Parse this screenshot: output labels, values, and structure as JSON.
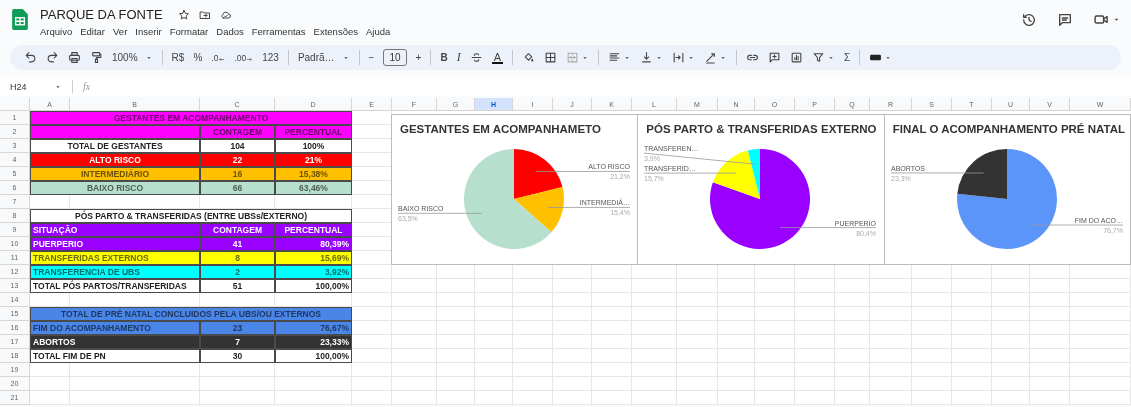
{
  "app": {
    "title": "PARQUE DA FONTE",
    "menu": [
      "Arquivo",
      "Editar",
      "Ver",
      "Inserir",
      "Formatar",
      "Dados",
      "Ferramentas",
      "Extensões",
      "Ajuda"
    ]
  },
  "toolbar": {
    "zoom": "100%",
    "currency": "R$",
    "percent": "%",
    "decrease_decimals": ".0",
    "increase_decimals": ".00",
    "number_format": "123",
    "font": "Padrã…",
    "decrease_size": "−",
    "font_size": "10",
    "increase_size": "+",
    "bold": "B",
    "italic": "I",
    "text_color": "A",
    "sum": "Σ"
  },
  "formula_bar": {
    "cell_ref": "H24",
    "fx": "fx"
  },
  "sheet": {
    "columns": [
      {
        "label": "A",
        "selected": false
      },
      {
        "label": "B",
        "selected": false
      },
      {
        "label": "C",
        "selected": false
      },
      {
        "label": "D",
        "selected": false
      },
      {
        "label": "E",
        "selected": false
      },
      {
        "label": "F",
        "selected": false
      },
      {
        "label": "G",
        "selected": false
      },
      {
        "label": "H",
        "selected": true
      },
      {
        "label": "I",
        "selected": false
      },
      {
        "label": "J",
        "selected": false
      },
      {
        "label": "K",
        "selected": false
      },
      {
        "label": "L",
        "selected": false
      },
      {
        "label": "M",
        "selected": false
      },
      {
        "label": "N",
        "selected": false
      },
      {
        "label": "O",
        "selected": false
      },
      {
        "label": "P",
        "selected": false
      },
      {
        "label": "Q",
        "selected": false
      },
      {
        "label": "R",
        "selected": false
      },
      {
        "label": "S",
        "selected": false
      },
      {
        "label": "T",
        "selected": false
      },
      {
        "label": "U",
        "selected": false
      },
      {
        "label": "V",
        "selected": false
      },
      {
        "label": "W",
        "selected": false
      }
    ],
    "rows": [
      "1",
      "2",
      "3",
      "4",
      "5",
      "6",
      "7",
      "8",
      "9",
      "10",
      "11",
      "12",
      "13",
      "14",
      "15",
      "16",
      "17",
      "18",
      "19",
      "20",
      "21"
    ]
  },
  "tables": [
    {
      "kind": "centered",
      "rows": [
        {
          "kind": "title",
          "cells": [
            "GESTANTES EM ACOMPANHAMENTO"
          ],
          "color": "#ff00ff"
        },
        {
          "kind": "header",
          "cells": [
            "",
            "CONTAGEM",
            "PERCENTUAL"
          ],
          "color": "#ff00ff"
        },
        {
          "kind": "data",
          "cells": [
            "TOTAL DE GESTANTES",
            "104",
            "100%"
          ],
          "color": "#ffffff"
        },
        {
          "kind": "data",
          "cells": [
            "ALTO RISCO",
            "22",
            "21%"
          ],
          "color": "#ff0000"
        },
        {
          "kind": "data",
          "cells": [
            "INTERMEDIÁRIO",
            "16",
            "15,38%"
          ],
          "color": "#ffc000"
        },
        {
          "kind": "data",
          "cells": [
            "BAIXO RISCO",
            "66",
            "63,46%"
          ],
          "color": "#b7dfcd"
        }
      ]
    },
    {
      "kind": "ledger",
      "rows": [
        {
          "kind": "title",
          "cells": [
            "PÓS PARTO & TRANSFERIDAS (ENTRE UBSs/EXTERNO)"
          ],
          "color": "#ffffff"
        },
        {
          "kind": "header",
          "cells": [
            "SITUAÇÃO",
            "CONTAGEM",
            "PERCENTUAL"
          ],
          "color": "#9900ff"
        },
        {
          "kind": "data",
          "cells": [
            "PUERPERIO",
            "41",
            "80,39%"
          ],
          "color": "#9900ff"
        },
        {
          "kind": "data",
          "cells": [
            "TRANSFERIDAS EXTERNOS",
            "8",
            "15,69%"
          ],
          "color": "#ffff00"
        },
        {
          "kind": "data",
          "cells": [
            "TRANSFERENCIA DE UBS",
            "2",
            "3,92%"
          ],
          "color": "#00ffff"
        },
        {
          "kind": "data",
          "cells": [
            "TOTAL PÓS PARTOS/TRANSFERIDAS",
            "51",
            "100,00%"
          ],
          "color": "#ffffff"
        }
      ]
    },
    {
      "kind": "ledger",
      "rows": [
        {
          "kind": "title",
          "cells": [
            "TOTAL DE PRÉ NATAL CONCLUIDOS PELA UBS/OU  EXTERNOS"
          ],
          "color": "#4a86e8"
        },
        {
          "kind": "data",
          "cells": [
            "FIM DO ACOMPANHAMENTO",
            "23",
            "76,67%"
          ],
          "color": "#4a86e8"
        },
        {
          "kind": "data",
          "cells": [
            "ABORTOS",
            "7",
            "23,33%"
          ],
          "color": "#333333"
        },
        {
          "kind": "data",
          "cells": [
            "TOTAL FIM DE PN",
            "30",
            "100,00%"
          ],
          "color": "#ffffff"
        }
      ]
    }
  ],
  "charts": [
    {
      "chart_data": {
        "type": "pie",
        "title": "GESTANTES EM ACOMPANHAMETO",
        "categories": [
          "ALTO RISCO",
          "INTERMEDIÁ…",
          "BAIXO RISCO"
        ],
        "series": [
          {
            "values": [
              21.2,
              15.4,
              63.5
            ]
          }
        ],
        "value_labels": [
          "21,2%",
          "15,4%",
          "63,5%"
        ],
        "colors": [
          "#ff0000",
          "#ffc000",
          "#b7dfcd"
        ]
      }
    },
    {
      "chart_data": {
        "type": "pie",
        "title": "PÓS PARTO & TRANSFERIDAS EXTERNO",
        "categories": [
          "PUERPERIO",
          "TRANSFERID…",
          "TRANSFEREN…"
        ],
        "series": [
          {
            "values": [
              80.4,
              15.7,
              3.9
            ]
          }
        ],
        "value_labels": [
          "80,4%",
          "15,7%",
          "3,9%"
        ],
        "colors": [
          "#9900ff",
          "#ffff00",
          "#00ffff"
        ]
      }
    },
    {
      "chart_data": {
        "type": "pie",
        "title": "FINAL O ACOMPANHAMENTO PRÉ NATAL",
        "categories": [
          "FIM DO ACO…",
          "ABORTOS"
        ],
        "series": [
          {
            "values": [
              76.7,
              23.3
            ]
          }
        ],
        "value_labels": [
          "76,7%",
          "23,3%"
        ],
        "colors": [
          "#5b95f9",
          "#333333"
        ]
      }
    }
  ]
}
